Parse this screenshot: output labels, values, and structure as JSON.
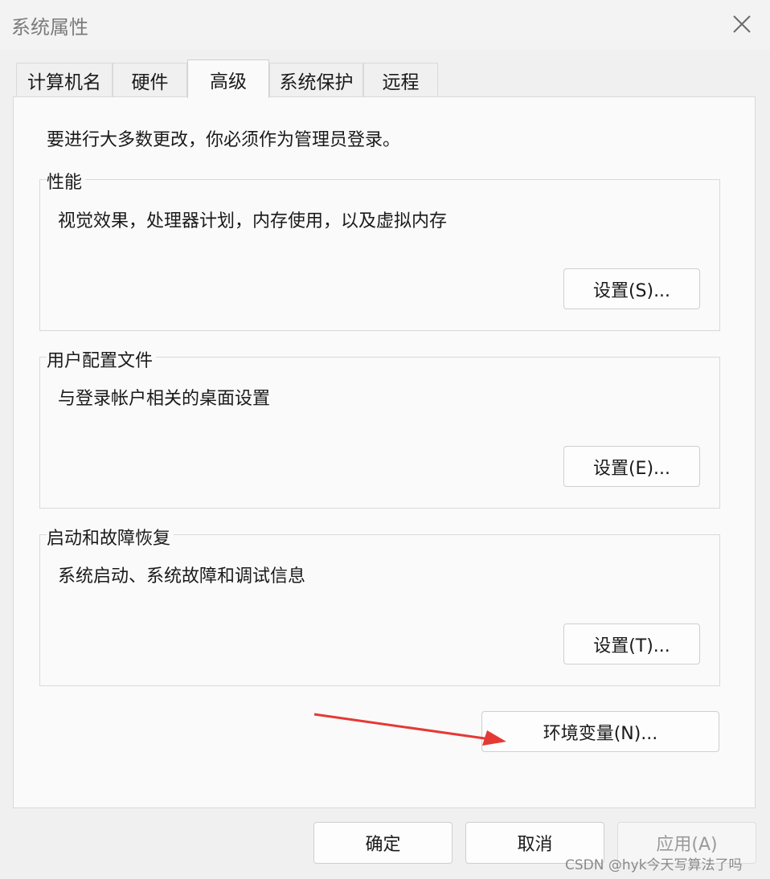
{
  "window": {
    "title": "系统属性"
  },
  "tabs": [
    {
      "label": "计算机名"
    },
    {
      "label": "硬件"
    },
    {
      "label": "高级"
    },
    {
      "label": "系统保护"
    },
    {
      "label": "远程"
    }
  ],
  "active_tab": "高级",
  "intro_text": "要进行大多数更改，你必须作为管理员登录。",
  "groups": {
    "performance": {
      "title": "性能",
      "description": "视觉效果，处理器计划，内存使用，以及虚拟内存",
      "button": "设置(S)..."
    },
    "user_profiles": {
      "title": "用户配置文件",
      "description": "与登录帐户相关的桌面设置",
      "button": "设置(E)..."
    },
    "startup_recovery": {
      "title": "启动和故障恢复",
      "description": "系统启动、系统故障和调试信息",
      "button": "设置(T)..."
    }
  },
  "env_button": "环境变量(N)...",
  "footer": {
    "ok": "确定",
    "cancel": "取消",
    "apply": "应用(A)"
  },
  "watermark": "CSDN @hyk今天写算法了吗",
  "colors": {
    "arrow": "#e53935"
  },
  "icons": {
    "close": "close-icon",
    "annotation": "red-arrow"
  }
}
